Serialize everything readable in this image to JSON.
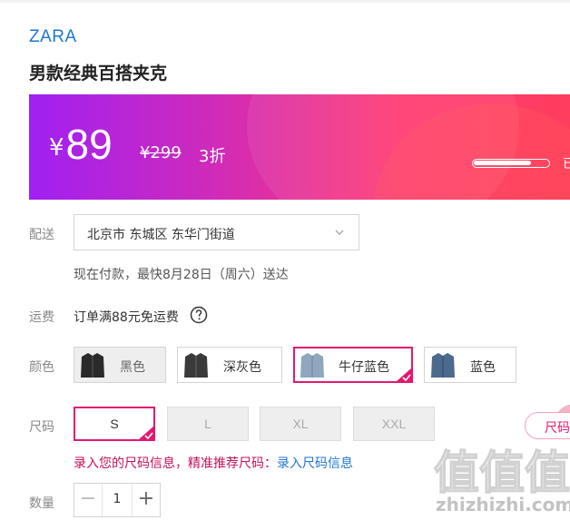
{
  "product": {
    "brand": "ZARA",
    "title": "男款经典百搭夹克"
  },
  "price": {
    "currency": "¥",
    "current": "89",
    "original": "¥299",
    "discount": "3折",
    "progress_fraction": 0.78,
    "progress_label": "已"
  },
  "delivery": {
    "label": "配送",
    "address": "北京市 东城区 东华门街道",
    "note": "现在付款，最快8月28日（周六）送达"
  },
  "shipping": {
    "label": "运费",
    "text": "订单满88元免运费"
  },
  "color": {
    "label": "颜色",
    "options": [
      {
        "label": "黑色",
        "state": "disabled",
        "thumb_color": "#2a2a2a"
      },
      {
        "label": "深灰色",
        "state": "normal",
        "thumb_color": "#3a3a3a"
      },
      {
        "label": "牛仔蓝色",
        "state": "selected",
        "thumb_color": "#8fa6bf"
      },
      {
        "label": "蓝色",
        "state": "normal",
        "thumb_color": "#4b6a8d"
      }
    ]
  },
  "size": {
    "label": "尺码",
    "options": [
      {
        "label": "S",
        "state": "selected"
      },
      {
        "label": "L",
        "state": "disabled"
      },
      {
        "label": "XL",
        "state": "disabled"
      },
      {
        "label": "XXL",
        "state": "disabled"
      }
    ],
    "tip_text": "录入您的尺码信息，精准推荐尺码：",
    "tip_link": "录入尺码信息",
    "side_tag": "尺码"
  },
  "quantity": {
    "label": "数量",
    "value": "1",
    "minus": "−",
    "plus": "+"
  },
  "watermark": {
    "glyphs": "值值值",
    "text": "zhizhizhi.com"
  },
  "colors": {
    "accent": "#e31870",
    "brand_link": "#1d77d2"
  }
}
